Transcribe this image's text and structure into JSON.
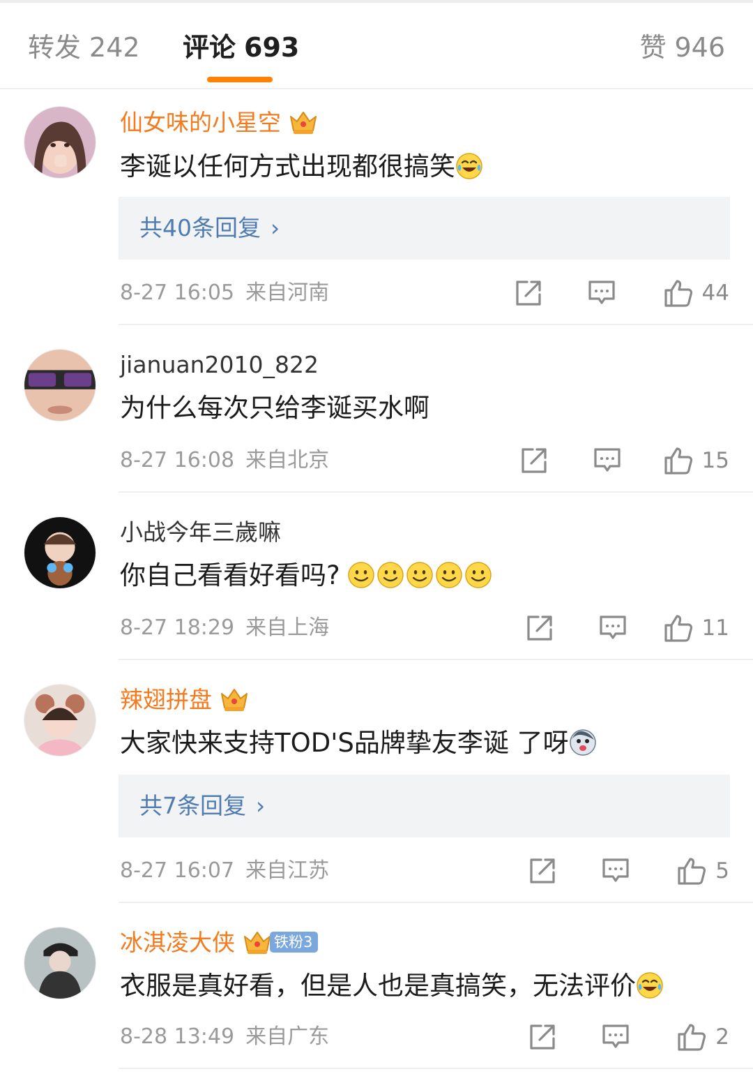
{
  "tabs": {
    "repost": {
      "label": "转发",
      "count": "242"
    },
    "comment": {
      "label": "评论",
      "count": "693"
    },
    "likes": {
      "label": "赞",
      "count": "946"
    }
  },
  "colors": {
    "accent": "#ff8200",
    "vip_name": "#f47a1e",
    "reply_link": "#4f7cb0"
  },
  "comments": [
    {
      "username": "仙女味的小星空",
      "vip_level": "5",
      "text": "李诞以任何方式出现都很搞笑",
      "emoji": "laughing-crying-emoji",
      "replies_label": "共40条回复",
      "time": "8-27 16:05",
      "location": "来自河南",
      "likes": "44"
    },
    {
      "username": "jianuan2010_822",
      "text": "为什么每次只给李诞买水啊",
      "time": "8-27 16:08",
      "location": "来自北京",
      "likes": "15"
    },
    {
      "username": "小战今年三歲嘛",
      "text": "你自己看看好看吗?",
      "emoji": "smile-emoji x5",
      "time": "8-27 18:29",
      "location": "来自上海",
      "likes": "11"
    },
    {
      "username": "辣翅拼盘",
      "vip_level": "2",
      "text": "大家快来支持TOD'S品牌挚友李诞 了呀",
      "emoji": "husky-emoji",
      "replies_label": "共7条回复",
      "time": "8-27 16:07",
      "location": "来自江苏",
      "likes": "5"
    },
    {
      "username": "冰淇凌大侠",
      "vip_level": "7",
      "fan_badge": "铁粉3",
      "text": "衣服是真好看，但是人也是真搞笑，无法评价",
      "emoji": "laughing-emoji",
      "time": "8-28 13:49",
      "location": "来自广东",
      "likes": "2"
    }
  ]
}
